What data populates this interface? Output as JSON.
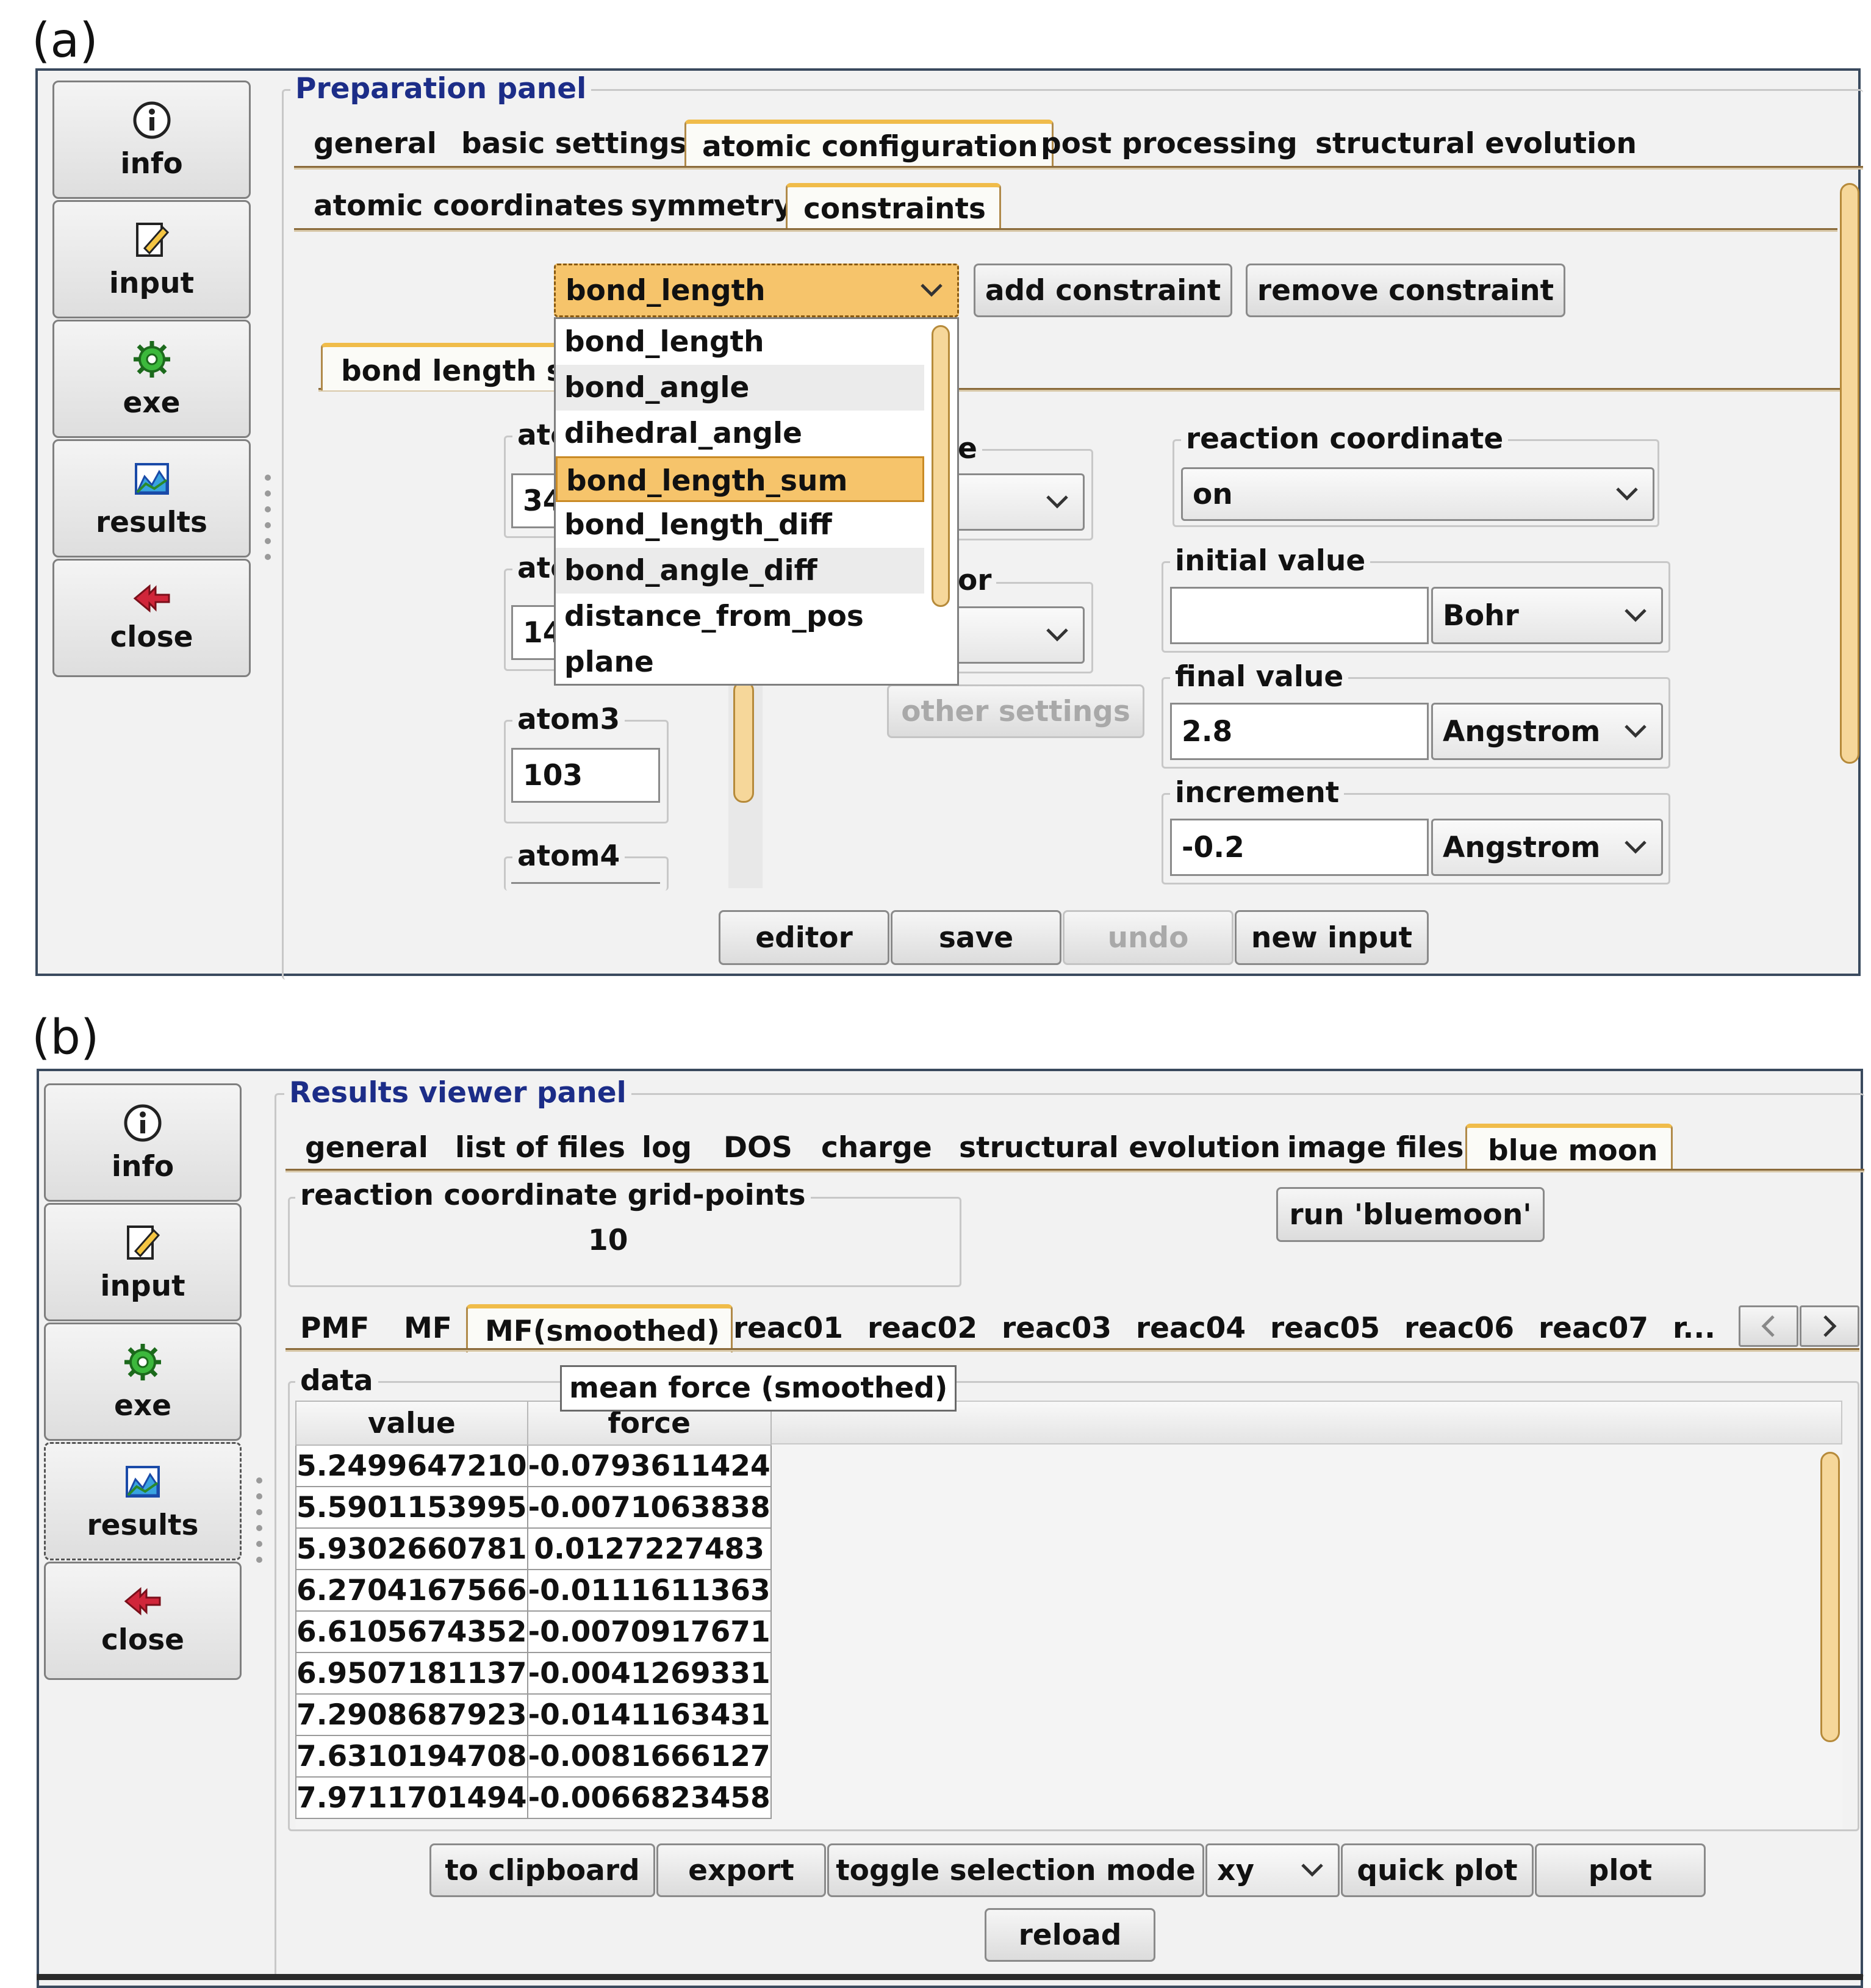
{
  "panel_a": {
    "tag": "(a)",
    "sidebar": [
      {
        "label": "info",
        "icon": "info-icon"
      },
      {
        "label": "input",
        "icon": "edit-icon"
      },
      {
        "label": "exe",
        "icon": "gear-icon"
      },
      {
        "label": "results",
        "icon": "chart-icon"
      },
      {
        "label": "close",
        "icon": "double-arrow-left-icon"
      }
    ],
    "title": "Preparation panel",
    "main_tabs": [
      "general",
      "basic settings",
      "atomic configuration",
      "post processing",
      "structural evolution"
    ],
    "sub_tabs": [
      "atomic coordinates",
      "symmetry",
      "constraints"
    ],
    "constraint_select": "bond_length",
    "add_constraint": "add constraint",
    "remove_constraint": "remove constraint",
    "dropdown_options": [
      "bond_length",
      "bond_angle",
      "dihedral_angle",
      "bond_length_sum",
      "bond_length_diff",
      "bond_angle_diff",
      "distance_from_pos",
      "plane"
    ],
    "dropdown_highlight": "bond_length_sum",
    "inner_tab": "bond length su",
    "atom1_label": "atc",
    "atom1_value": "34",
    "atom2_label": "atc",
    "atom2_value": "14",
    "atom3_label": "atom3",
    "atom3_value": "103",
    "atom4_label": "atom4",
    "hidden_label_1": "e",
    "hidden_label_2": "or",
    "hidden_select_1": "-",
    "hidden_select_2": "-",
    "other_settings": "other settings",
    "reaction_coordinate_label": "reaction coordinate",
    "reaction_coordinate_value": "on",
    "initial_value_label": "initial value",
    "initial_value": "",
    "initial_unit": "Bohr",
    "final_value_label": "final value",
    "final_value": "2.8",
    "final_unit": "Angstrom",
    "increment_label": "increment",
    "increment_value": "-0.2",
    "increment_unit": "Angstrom",
    "bottom_buttons": [
      "editor",
      "save",
      "undo",
      "new input"
    ]
  },
  "panel_b": {
    "tag": "(b)",
    "sidebar": [
      {
        "label": "info",
        "icon": "info-icon"
      },
      {
        "label": "input",
        "icon": "edit-icon"
      },
      {
        "label": "exe",
        "icon": "gear-icon"
      },
      {
        "label": "results",
        "icon": "chart-icon"
      },
      {
        "label": "close",
        "icon": "double-arrow-left-icon"
      }
    ],
    "title": "Results viewer panel",
    "main_tabs": [
      "general",
      "list of files",
      "log",
      "DOS",
      "charge",
      "structural evolution",
      "image files",
      "blue moon"
    ],
    "grid_points_label": "reaction coordinate grid-points",
    "grid_points_value": "10",
    "run_bluemoon": "run 'bluemoon'",
    "sub_tabs": [
      "PMF",
      "MF",
      "MF(smoothed)",
      "reac01",
      "reac02",
      "reac03",
      "reac04",
      "reac05",
      "reac06",
      "reac07",
      "r..."
    ],
    "tooltip": "mean force (smoothed)",
    "data_label": "data",
    "table": {
      "headers": [
        "value",
        "force"
      ],
      "rows": [
        [
          "5.2499647210",
          "-0.0793611424"
        ],
        [
          "5.5901153995",
          "-0.0071063838"
        ],
        [
          "5.9302660781",
          "0.0127227483"
        ],
        [
          "6.2704167566",
          "-0.0111611363"
        ],
        [
          "6.6105674352",
          "-0.0070917671"
        ],
        [
          "6.9507181137",
          "-0.0041269331"
        ],
        [
          "7.2908687923",
          "-0.0141163431"
        ],
        [
          "7.6310194708",
          "-0.0081666127"
        ],
        [
          "7.9711701494",
          "-0.0066823458"
        ]
      ]
    },
    "bottom_buttons": [
      "to clipboard",
      "export",
      "toggle selection mode"
    ],
    "selection_mode": "xy",
    "quick_plot": "quick plot",
    "plot": "plot",
    "reload": "reload"
  }
}
